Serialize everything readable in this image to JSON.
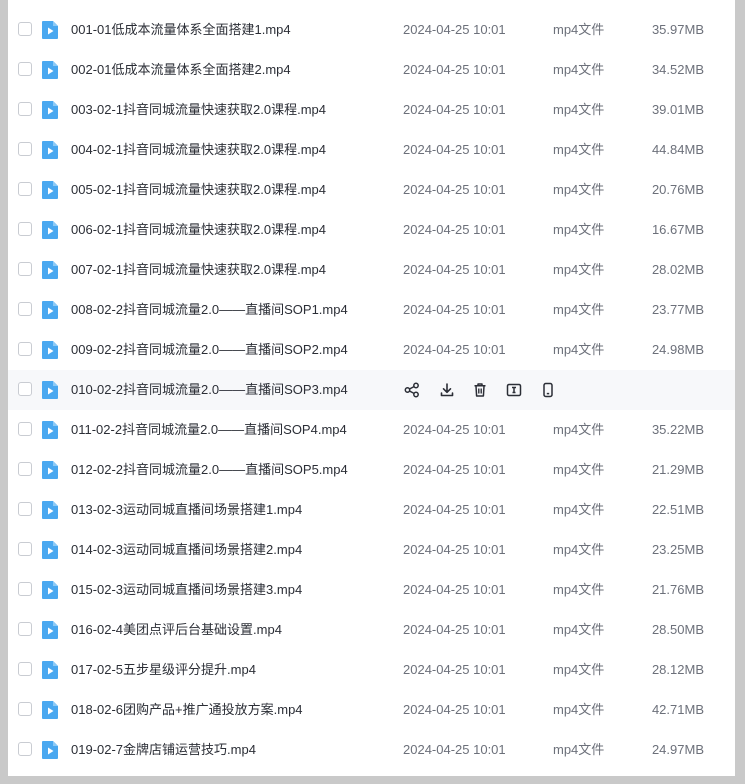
{
  "files": [
    {
      "name": "001-01低成本流量体系全面搭建1.mp4",
      "date": "2024-04-25 10:01",
      "type": "mp4文件",
      "size": "35.97MB"
    },
    {
      "name": "002-01低成本流量体系全面搭建2.mp4",
      "date": "2024-04-25 10:01",
      "type": "mp4文件",
      "size": "34.52MB"
    },
    {
      "name": "003-02-1抖音同城流量快速获取2.0课程.mp4",
      "date": "2024-04-25 10:01",
      "type": "mp4文件",
      "size": "39.01MB"
    },
    {
      "name": "004-02-1抖音同城流量快速获取2.0课程.mp4",
      "date": "2024-04-25 10:01",
      "type": "mp4文件",
      "size": "44.84MB"
    },
    {
      "name": "005-02-1抖音同城流量快速获取2.0课程.mp4",
      "date": "2024-04-25 10:01",
      "type": "mp4文件",
      "size": "20.76MB"
    },
    {
      "name": "006-02-1抖音同城流量快速获取2.0课程.mp4",
      "date": "2024-04-25 10:01",
      "type": "mp4文件",
      "size": "16.67MB"
    },
    {
      "name": "007-02-1抖音同城流量快速获取2.0课程.mp4",
      "date": "2024-04-25 10:01",
      "type": "mp4文件",
      "size": "28.02MB"
    },
    {
      "name": "008-02-2抖音同城流量2.0——直播间SOP1.mp4",
      "date": "2024-04-25 10:01",
      "type": "mp4文件",
      "size": "23.77MB"
    },
    {
      "name": "009-02-2抖音同城流量2.0——直播间SOP2.mp4",
      "date": "2024-04-25 10:01",
      "type": "mp4文件",
      "size": "24.98MB"
    },
    {
      "name": "010-02-2抖音同城流量2.0——直播间SOP3.mp4",
      "date": "",
      "type": "",
      "size": "",
      "hover": true
    },
    {
      "name": "011-02-2抖音同城流量2.0——直播间SOP4.mp4",
      "date": "2024-04-25 10:01",
      "type": "mp4文件",
      "size": "35.22MB"
    },
    {
      "name": "012-02-2抖音同城流量2.0——直播间SOP5.mp4",
      "date": "2024-04-25 10:01",
      "type": "mp4文件",
      "size": "21.29MB"
    },
    {
      "name": "013-02-3运动同城直播间场景搭建1.mp4",
      "date": "2024-04-25 10:01",
      "type": "mp4文件",
      "size": "22.51MB"
    },
    {
      "name": "014-02-3运动同城直播间场景搭建2.mp4",
      "date": "2024-04-25 10:01",
      "type": "mp4文件",
      "size": "23.25MB"
    },
    {
      "name": "015-02-3运动同城直播间场景搭建3.mp4",
      "date": "2024-04-25 10:01",
      "type": "mp4文件",
      "size": "21.76MB"
    },
    {
      "name": "016-02-4美团点评后台基础设置.mp4",
      "date": "2024-04-25 10:01",
      "type": "mp4文件",
      "size": "28.50MB"
    },
    {
      "name": "017-02-5五步星级评分提升.mp4",
      "date": "2024-04-25 10:01",
      "type": "mp4文件",
      "size": "28.12MB"
    },
    {
      "name": "018-02-6团购产品+推广通投放方案.mp4",
      "date": "2024-04-25 10:01",
      "type": "mp4文件",
      "size": "42.71MB"
    },
    {
      "name": "019-02-7金牌店铺运营技巧.mp4",
      "date": "2024-04-25 10:01",
      "type": "mp4文件",
      "size": "24.97MB"
    }
  ],
  "row_actions": [
    {
      "icon": "share-icon"
    },
    {
      "icon": "download-icon"
    },
    {
      "icon": "delete-icon"
    },
    {
      "icon": "rename-icon"
    },
    {
      "icon": "mobile-icon"
    }
  ],
  "colors": {
    "video_icon": "#4aa8f0",
    "text": "#2b2e36",
    "meta_text": "#6c707a",
    "hover_bg": "#f7f8fa",
    "frame_bg": "#c9c9c9"
  }
}
